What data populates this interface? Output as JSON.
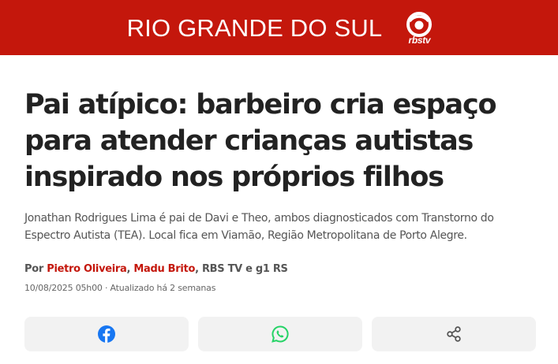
{
  "header": {
    "region_title": "RIO GRANDE DO SUL",
    "logo_text": "rbstv",
    "background_color": "#c4170c"
  },
  "article": {
    "headline": "Pai atípico: barbeiro cria espaço para atender crianças autistas inspirado nos próprios filhos",
    "subtitle": "Jonathan Rodrigues Lima é pai de Davi e Theo, ambos diagnosticados com Transtorno do Espectro Autista (TEA). Local fica em Viamão, Região Metropolitana de Porto Alegre.",
    "byline": {
      "prefix": "Por",
      "authors": [
        "Pietro Oliveira",
        "Madu Brito"
      ],
      "separator": ",",
      "suffix": "RBS TV e g1 RS"
    },
    "dateline": "10/08/2025 05h00 · Atualizado há 2 semanas"
  },
  "share_buttons": [
    {
      "icon": "facebook-icon",
      "color": "#1877f2"
    },
    {
      "icon": "whatsapp-icon",
      "color": "#25d366"
    },
    {
      "icon": "share-icon",
      "color": "#555555"
    }
  ]
}
